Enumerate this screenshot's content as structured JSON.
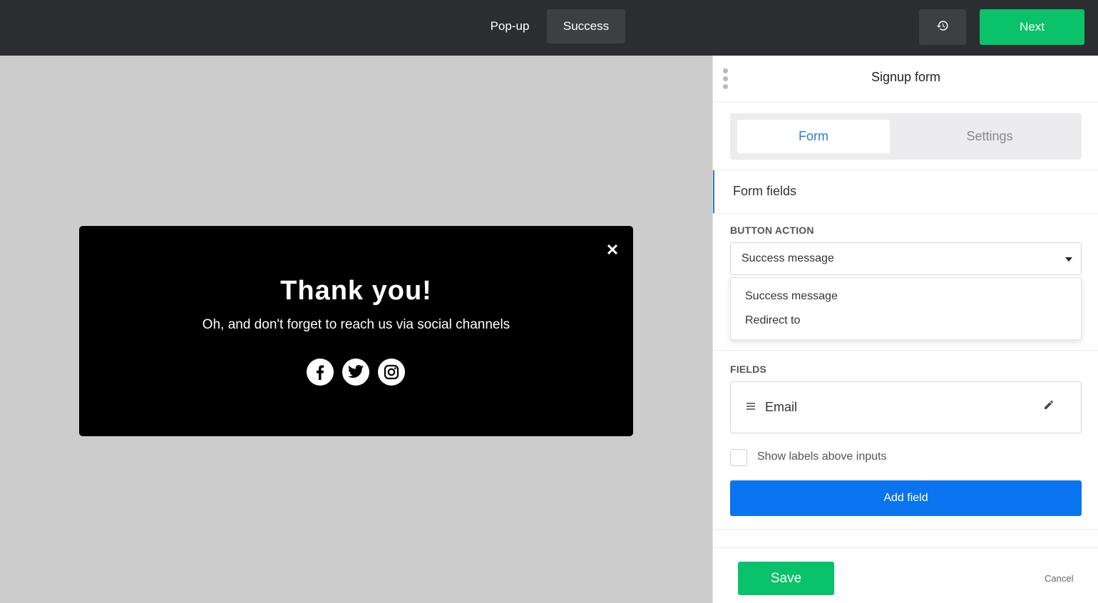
{
  "topbar": {
    "tabs": [
      {
        "label": "Pop-up",
        "active": false
      },
      {
        "label": "Success",
        "active": true
      }
    ],
    "history_icon": "history-icon",
    "next_label": "Next"
  },
  "popup": {
    "close_icon": "close-icon",
    "close_glyph": "✕",
    "title": "Thank you!",
    "subtitle": "Oh, and don't forget to reach us via social channels",
    "socials": [
      "facebook-icon",
      "twitter-icon",
      "instagram-icon"
    ]
  },
  "panel": {
    "title": "Signup form",
    "tabs": {
      "form": "Form",
      "settings": "Settings"
    },
    "form_fields_label": "Form fields",
    "button_action": {
      "label": "BUTTON ACTION",
      "selected": "Success message",
      "options": [
        "Success message",
        "Redirect to"
      ]
    },
    "fields": {
      "label": "FIELDS",
      "items": [
        {
          "name": "Email"
        }
      ]
    },
    "show_labels": {
      "label": "Show labels above inputs",
      "checked": false
    },
    "add_field_label": "Add field",
    "footer": {
      "save": "Save",
      "cancel": "Cancel"
    }
  },
  "colors": {
    "topbar": "#2c2d30",
    "accent_green": "#09c269",
    "accent_blue": "#0a73f0",
    "link_blue": "#2f7bc8",
    "canvas": "#cccccc"
  }
}
